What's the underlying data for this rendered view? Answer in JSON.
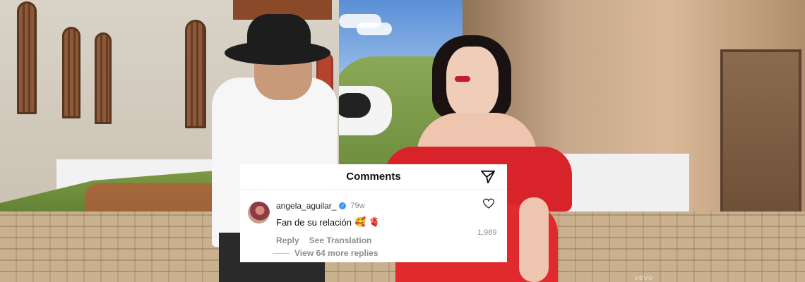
{
  "card": {
    "title": "Comments",
    "share_icon": "send-icon"
  },
  "comment": {
    "username": "angela_aguilar_",
    "verified_icon": "verified-badge-icon",
    "age": "79w",
    "text": "Fan de su relación",
    "emojis": [
      "🥰",
      "🫀"
    ],
    "reply_label": "Reply",
    "translation_label": "See Translation",
    "like_icon": "heart-icon",
    "like_count": "1,989",
    "view_more_label": "View 64 more replies"
  },
  "watermark": "vevo"
}
